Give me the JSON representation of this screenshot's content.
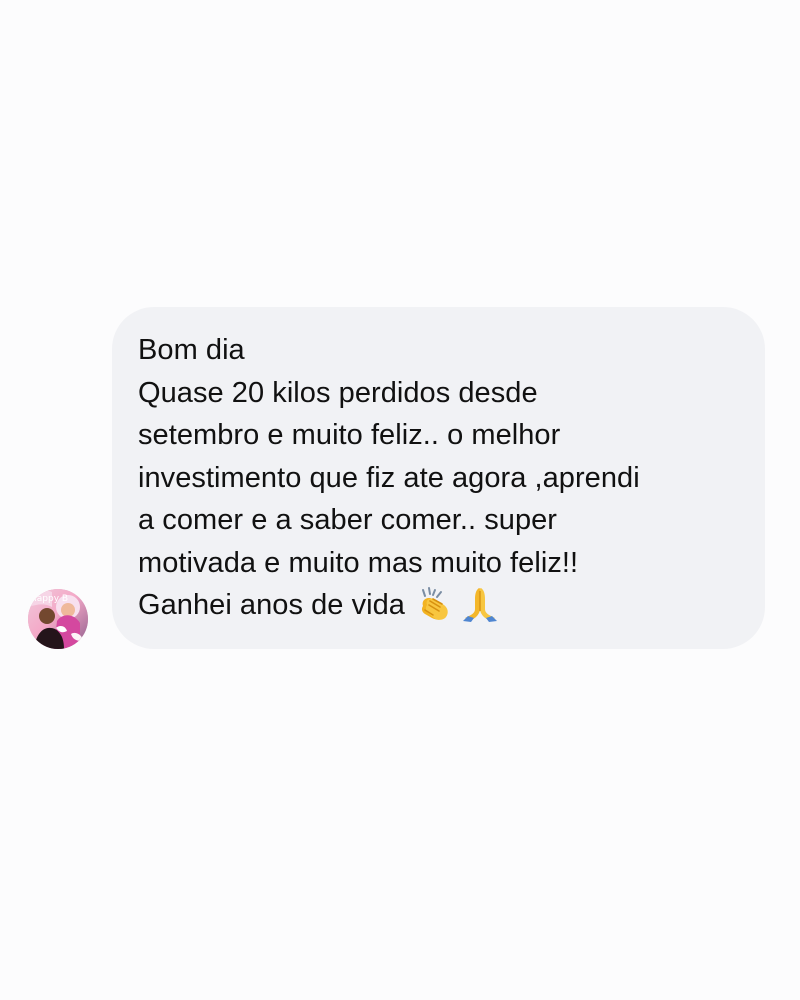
{
  "conversation": {
    "message": {
      "lines": [
        "Bom dia",
        "Quase 20 kilos perdidos desde",
        "setembro  e muito feliz.. o melhor",
        "investimento que fiz ate agora ,aprendi",
        "a comer e a saber comer.. super",
        "motivada e muito mas muito feliz!!",
        "Ganhei anos de vida"
      ],
      "emoji": [
        "clapping-hands-icon",
        "folded-hands-icon"
      ]
    },
    "avatar_label_fragment": "Happy B"
  },
  "colors": {
    "background": "#fcfcfd",
    "bubble": "#f1f2f5",
    "text": "#111111"
  }
}
